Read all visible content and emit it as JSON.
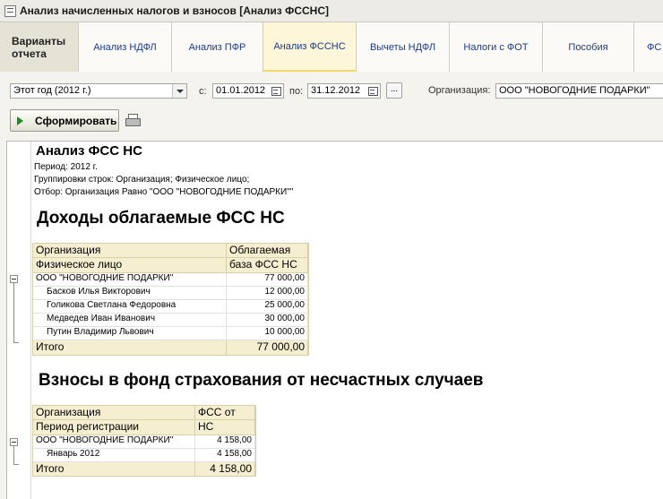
{
  "window": {
    "title": "Анализ начисленных налогов и взносов [Анализ ФССНС]"
  },
  "tabs": [
    {
      "label": "Варианты отчета"
    },
    {
      "label": "Анализ НДФЛ"
    },
    {
      "label": "Анализ ПФР"
    },
    {
      "label": "Анализ ФССНС"
    },
    {
      "label": "Вычеты НДФЛ"
    },
    {
      "label": "Налоги с ФОТ"
    },
    {
      "label": "Пособия"
    },
    {
      "label": "ФС"
    }
  ],
  "toolbar": {
    "period_value": "Этот год (2012 г.)",
    "from_label": "с:",
    "from_value": "01.01.2012",
    "to_label": "по:",
    "to_value": "31.12.2012",
    "dots_label": "...",
    "org_label": "Организация:",
    "org_value": "ООО \"НОВОГОДНИЕ ПОДАРКИ\"",
    "generate_label": "Сформировать"
  },
  "report": {
    "title": "Анализ ФСС НС",
    "period": "Период: 2012 г.",
    "grouping": "Группировки строк: Организация; Физическое лицо;",
    "filter": "Отбор: Организация Равно \"ООО \"НОВОГОДНИЕ ПОДАРКИ\"\"",
    "section1": {
      "heading": "Доходы облагаемые ФСС НС",
      "col1_h1": "Организация",
      "col1_h2": "Физическое лицо",
      "col2_h1": "Облагаемая",
      "col2_h2": "база ФСС НС",
      "rows": [
        {
          "name": "ООО \"НОВОГОДНИЕ ПОДАРКИ\"",
          "value": "77 000,00"
        },
        {
          "name": "Басков Илья Викторович",
          "value": "12 000,00"
        },
        {
          "name": "Голикова Светлана Федоровна",
          "value": "25 000,00"
        },
        {
          "name": "Медведев Иван Иванович",
          "value": "30 000,00"
        },
        {
          "name": "Путин Владимир Львович",
          "value": "10 000,00"
        }
      ],
      "total_label": "Итого",
      "total_value": "77 000,00"
    },
    "section2": {
      "heading": "Взносы в фонд страхования от несчастных случаев",
      "col1_h1": "Организация",
      "col1_h2": "Период регистрации",
      "col2_h1": "ФСС от",
      "col2_h2": "НС",
      "rows": [
        {
          "name": "ООО \"НОВОГОДНИЕ ПОДАРКИ\"",
          "value": "4 158,00"
        },
        {
          "name": "Январь 2012",
          "value": "4 158,00"
        }
      ],
      "total_label": "Итого",
      "total_value": "4 158,00"
    }
  }
}
